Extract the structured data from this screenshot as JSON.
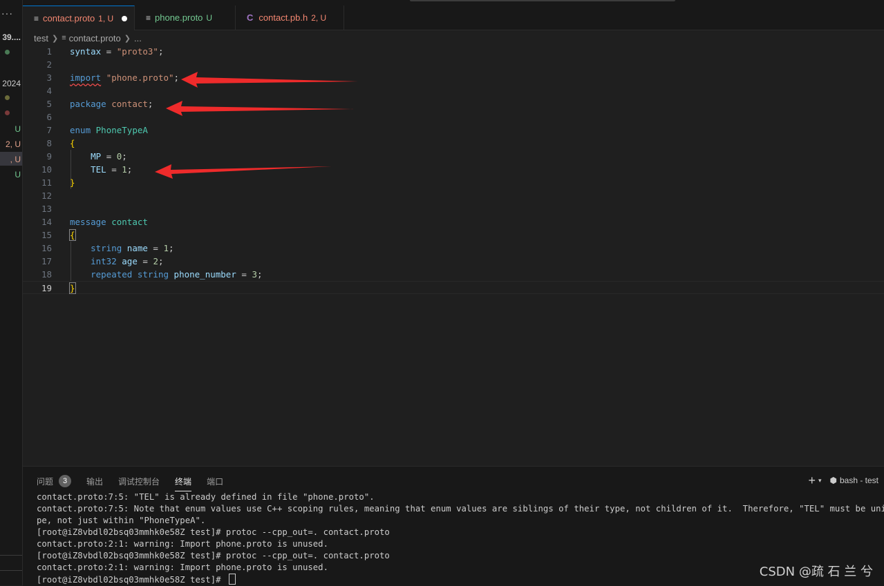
{
  "sidebar": {
    "items": [
      {
        "label": "39....",
        "color": "#cccccc"
      },
      {
        "label": "2024",
        "color": "#cccccc"
      },
      {
        "label": "U",
        "color": "#73c991"
      },
      {
        "label": "2, U",
        "color": "#e2a28b"
      },
      {
        "label": ", U",
        "color": "#e2a28b"
      },
      {
        "label": "U",
        "color": "#73c991"
      }
    ],
    "more_icon": "ellipsis-icon"
  },
  "tabs": [
    {
      "icon": "lines-icon",
      "label": "contact.proto",
      "status": "1, U",
      "color": "#f48771",
      "active": true,
      "modified": true
    },
    {
      "icon": "lines-icon",
      "label": "phone.proto",
      "status": "U",
      "color": "#73c991",
      "active": false
    },
    {
      "icon": "c-lang-icon",
      "icon_text": "C",
      "label": "contact.pb.h",
      "status": "2, U",
      "color": "#f48771",
      "active": false
    }
  ],
  "breadcrumb": {
    "folder": "test",
    "file": "contact.proto",
    "tail": "..."
  },
  "editor": {
    "line_numbers": [
      "1",
      "2",
      "3",
      "4",
      "5",
      "6",
      "7",
      "8",
      "9",
      "10",
      "11",
      "12",
      "13",
      "14",
      "15",
      "16",
      "17",
      "18",
      "19"
    ],
    "active_line": "19"
  },
  "panel": {
    "tabs": [
      {
        "label": "问题",
        "badge": "3"
      },
      {
        "label": "输出"
      },
      {
        "label": "调试控制台"
      },
      {
        "label": "终端",
        "active": true
      },
      {
        "label": "端口"
      }
    ],
    "terminal_name": "bash - test",
    "terminal_lines": [
      "contact.proto:7:5: \"TEL\" is already defined in file \"phone.proto\".",
      "contact.proto:7:5: Note that enum values use C++ scoping rules, meaning that enum values are siblings of their type, not children of it.  Therefore, \"TEL\" must be unique within \"contact\", not just within \"PhoneTypeA\".",
      "pe, not just within \"PhoneTypeA\".",
      "[root@iZ8vbdl02bsq03mmhk0e58Z test]# protoc --cpp_out=. contact.proto",
      "contact.proto:2:1: warning: Import phone.proto is unused.",
      "[root@iZ8vbdl02bsq03mmhk0e58Z test]# protoc --cpp_out=. contact.proto",
      "contact.proto:2:1: warning: Import phone.proto is unused.",
      "[root@iZ8vbdl02bsq03mmhk0e58Z test]# "
    ]
  },
  "watermark": "CSDN @疏 石 兰 兮"
}
